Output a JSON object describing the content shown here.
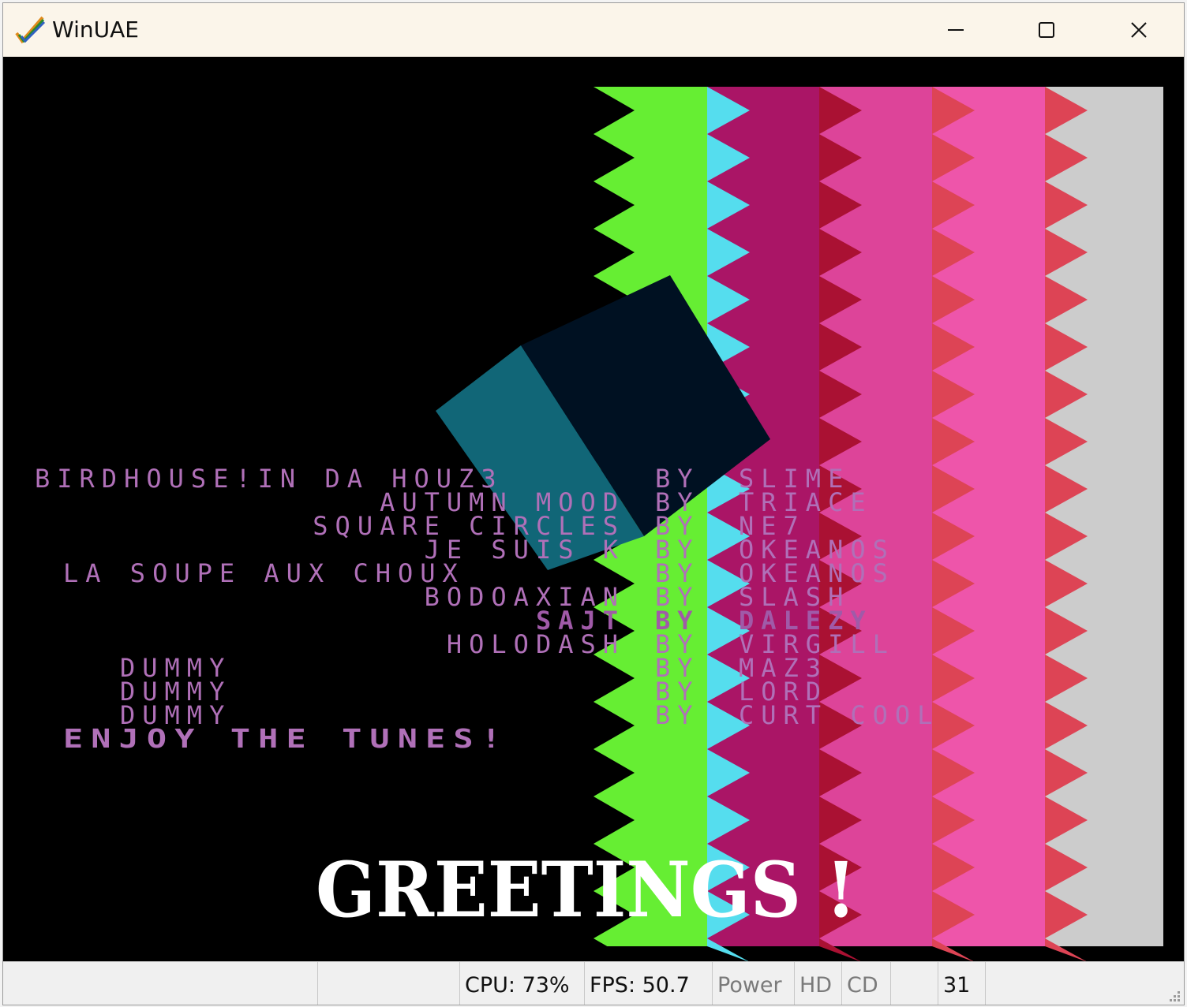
{
  "window": {
    "title": "WinUAE",
    "icon": "winuae-checkmark-icon",
    "controls": {
      "minimize": "minimize-icon",
      "maximize": "maximize-icon",
      "close": "close-icon"
    }
  },
  "screen": {
    "credits": [
      {
        "title": "BIRDHOUSE!IN DA HOUZ3",
        "by": "BY",
        "author": "SLIME"
      },
      {
        "title": "AUTUMN MOOD",
        "by": "BY",
        "author": "TRIACE"
      },
      {
        "title": "SQUARE CIRCLES",
        "by": "BY",
        "author": "NE7"
      },
      {
        "title": "JE SUIS K",
        "by": "BY",
        "author": "OKEANOS"
      },
      {
        "title": "LA SOUPE AUX CHOUX",
        "by": "BY",
        "author": "OKEANOS"
      },
      {
        "title": "BODOAXIAN",
        "by": "BY",
        "author": "SLASH"
      },
      {
        "title": "SAJT",
        "by": "BY",
        "author": "DALEZY"
      },
      {
        "title": "HOLODASH",
        "by": "BY",
        "author": "VIRGILL"
      },
      {
        "title": "DUMMY",
        "by": "BY",
        "author": "MAZ3"
      },
      {
        "title": "DUMMY",
        "by": "BY",
        "author": "LORD"
      },
      {
        "title": "DUMMY",
        "by": "BY",
        "author": "CURT COOL"
      }
    ],
    "footer_line": "ENJOY THE TUNES!",
    "banner": "GREETINGS !",
    "colors": {
      "text": "#b070b8",
      "text_highlight": "#a05aa8",
      "stripe_green": "#66ee33",
      "stripe_cyan": "#55ddee",
      "stripe_magenta": "#aa1566",
      "stripe_pink": "#dd4499",
      "stripe_red": "#aa1133",
      "stripe_hotpink": "#ee55aa",
      "stripe_salmon": "#dd4455",
      "stripe_grey": "#cccccc",
      "cube_face_light": "#116677",
      "cube_face_dark": "#001122"
    }
  },
  "statusbar": {
    "cpu": "CPU: 73%",
    "fps": "FPS: 50.7",
    "power": "Power",
    "hd": "HD",
    "cd": "CD",
    "counter": "31"
  }
}
